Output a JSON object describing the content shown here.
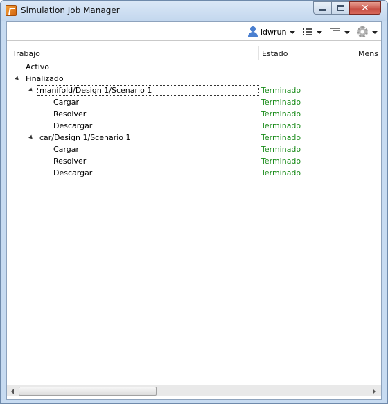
{
  "window": {
    "title": "Simulation Job Manager"
  },
  "toolbar": {
    "user": "ldwrun",
    "icons": [
      "user-icon",
      "list-view-icon",
      "lines-icon",
      "gear-icon"
    ]
  },
  "columns": [
    "Trabajo",
    "Estado",
    "Mens"
  ],
  "tree": {
    "active_label": "Activo",
    "finished_label": "Finalizado",
    "jobs": [
      {
        "name": "manifold/Design 1/Scenario 1",
        "status": "Terminado",
        "steps": [
          {
            "name": "Cargar",
            "status": "Terminado"
          },
          {
            "name": "Resolver",
            "status": "Terminado"
          },
          {
            "name": "Descargar",
            "status": "Terminado"
          }
        ]
      },
      {
        "name": "car/Design 1/Scenario 1",
        "status": "Terminado",
        "steps": [
          {
            "name": "Cargar",
            "status": "Terminado"
          },
          {
            "name": "Resolver",
            "status": "Terminado"
          },
          {
            "name": "Descargar",
            "status": "Terminado"
          }
        ]
      }
    ]
  },
  "colors": {
    "status_done": "#1b8c1b",
    "titlebar": "#c7dbf1"
  }
}
